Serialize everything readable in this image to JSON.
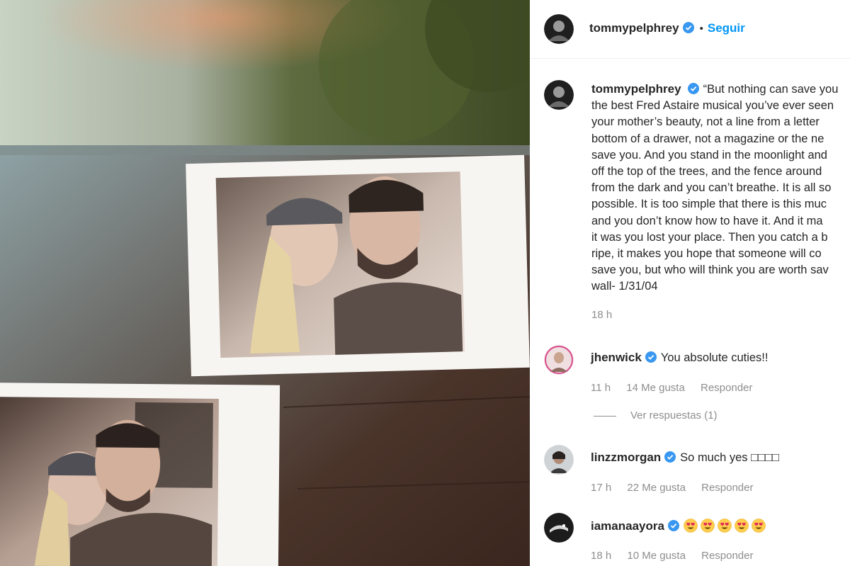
{
  "post": {
    "username": "tommypelphrey",
    "follow_label": "Seguir",
    "separator": "•"
  },
  "caption": {
    "username": "tommypelphrey",
    "text": "“But nothing can save you\nthe best Fred Astaire musical you’ve ever seen\nyour mother’s beauty, not a line from a letter\nbottom of a drawer, not a magazine or the ne\nsave you. And you stand in the moonlight and\noff the top of the trees, and the fence around\nfrom the dark and you can’t breathe. It is all so\npossible. It is too simple that there is this muc\nand you don’t know how to have it. And it ma\nit was you lost your place. Then you catch a b\nripe, it makes you hope that someone will co\nsave you, but who will think you are worth sav\nwall- 1/31/04",
    "time": "18 h"
  },
  "comments": [
    {
      "username": "jhenwick",
      "text": "You absolute cuties!!",
      "time": "11 h",
      "likes": "14 Me gusta",
      "reply": "Responder"
    },
    {
      "username": "linzzmorgan",
      "text": "So much yes □□□□",
      "time": "17 h",
      "likes": "22 Me gusta",
      "reply": "Responder"
    },
    {
      "username": "iamanaayora",
      "text": "",
      "emoji_count": 5,
      "emoji_icon": "heart-eyes-emoji-icon",
      "time": "18 h",
      "likes": "10 Me gusta",
      "reply": "Responder"
    }
  ],
  "view_replies_label": "Ver respuestas (1)",
  "colors": {
    "follow_blue": "#0095f6",
    "verified_blue": "#3897f0",
    "muted_text": "#8e8e8e",
    "primary_text": "#262626"
  }
}
